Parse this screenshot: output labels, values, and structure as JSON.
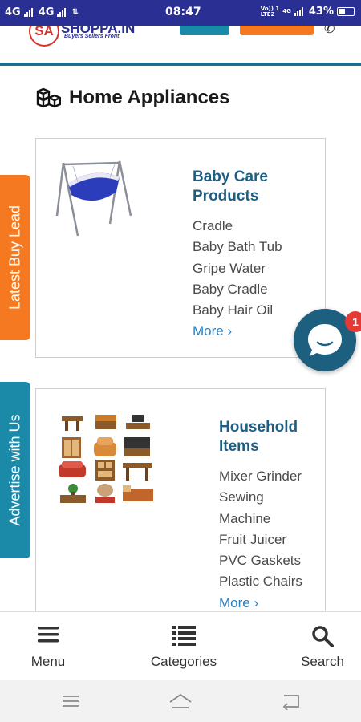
{
  "status_bar": {
    "net1": "4G",
    "net2": "4G",
    "time": "08:47",
    "volte": "Vo)) 1",
    "lte": "LTE2",
    "net3": "4G",
    "battery": "43%"
  },
  "header": {
    "logo_mark": "SA",
    "logo_text": "SHOPPA.IN",
    "tagline": "Buyers Sellers Front"
  },
  "section": {
    "title": "Home Appliances",
    "icon": "boxes-icon"
  },
  "cards": [
    {
      "title": "Baby Care Products",
      "items": [
        "Cradle",
        "Baby Bath Tub",
        "Gripe Water",
        "Baby Cradle",
        "Baby Hair Oil"
      ],
      "more": "More ›"
    },
    {
      "title": "Household Items",
      "items": [
        "Mixer Grinder",
        "Sewing Machine",
        "Fruit Juicer",
        "PVC Gaskets",
        "Plastic Chairs"
      ],
      "more": "More ›"
    }
  ],
  "side_tabs": {
    "buy_lead": "Latest Buy Lead",
    "advertise": "Advertise with Us"
  },
  "chat": {
    "badge": "1",
    "icon": "chat-bubble-icon"
  },
  "bottom_nav": [
    {
      "label": "Menu",
      "icon": "hamburger-icon"
    },
    {
      "label": "Categories",
      "icon": "list-icon"
    },
    {
      "label": "Search",
      "icon": "search-icon"
    }
  ],
  "colors": {
    "status_bar": "#2a2f93",
    "accent_orange": "#f47920",
    "accent_teal": "#1a8aa8",
    "title_blue": "#1f5e83",
    "link_blue": "#2a7fbf",
    "chat_bg": "#1c5f7e",
    "badge_red": "#e53935"
  }
}
